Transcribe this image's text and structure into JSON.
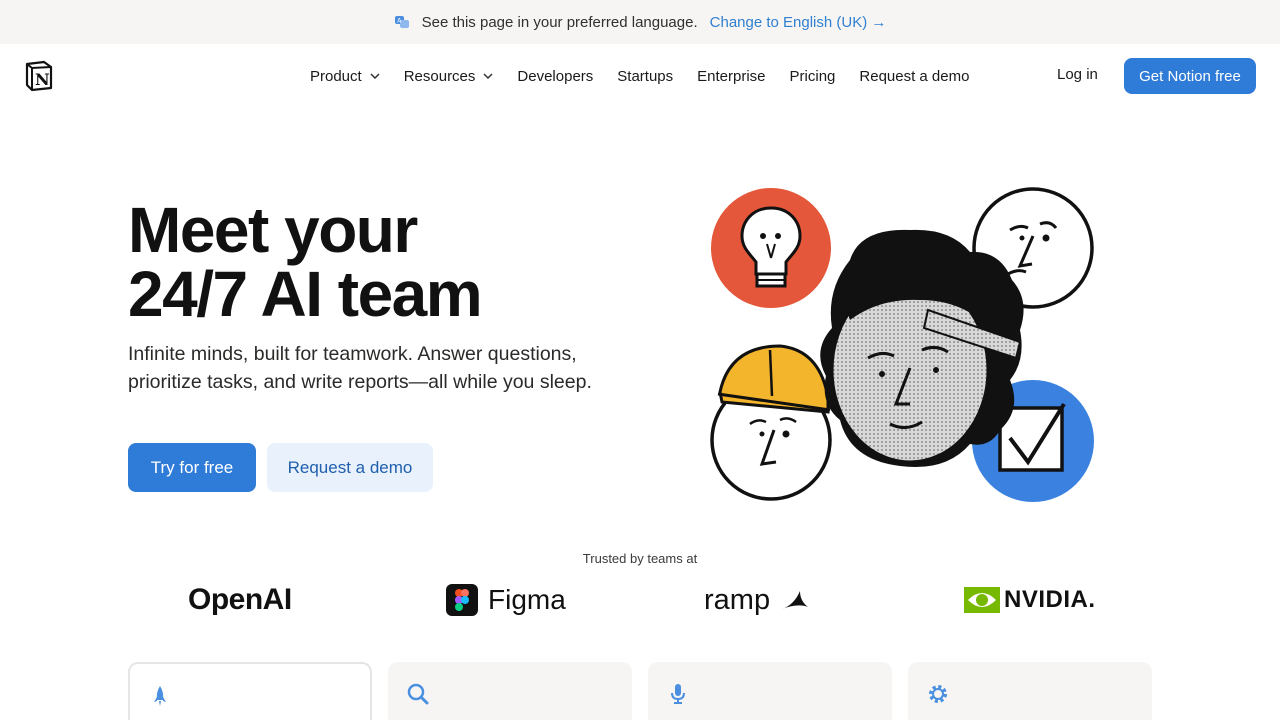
{
  "banner": {
    "text": "See this page in your preferred language.",
    "link": "Change to English (UK) →"
  },
  "nav": {
    "items": [
      {
        "label": "Product",
        "dropdown": true
      },
      {
        "label": "Resources",
        "dropdown": true
      },
      {
        "label": "Developers",
        "dropdown": false
      },
      {
        "label": "Startups",
        "dropdown": false
      },
      {
        "label": "Enterprise",
        "dropdown": false
      },
      {
        "label": "Pricing",
        "dropdown": false
      },
      {
        "label": "Request a demo",
        "dropdown": false
      }
    ],
    "login": "Log in",
    "cta": "Get Notion free"
  },
  "hero": {
    "title_line1": "Meet your",
    "title_line2": "24/7 AI team",
    "subtitle": "Infinite minds, built for teamwork. Answer questions, prioritize tasks, and write reports—all while you sleep.",
    "primary_button": "Try for free",
    "secondary_button": "Request a demo"
  },
  "trusted": {
    "label": "Trusted by teams at",
    "brands": [
      "OpenAI",
      "Figma",
      "ramp",
      "NVIDIA."
    ]
  },
  "cards": [
    {
      "icon": "rocket-icon",
      "active": true
    },
    {
      "icon": "search-icon",
      "active": false
    },
    {
      "icon": "microphone-icon",
      "active": false
    },
    {
      "icon": "gear-icon",
      "active": false
    }
  ],
  "colors": {
    "accent": "#2f7bd8",
    "link": "#2f80d1",
    "banner_bg": "#f6f5f4",
    "secondary_btn_bg": "#e8f1fc",
    "orange": "#e4573a",
    "blue_circle": "#3b82e0",
    "helmet": "#f3b52b",
    "nvidia_green": "#76b900"
  }
}
